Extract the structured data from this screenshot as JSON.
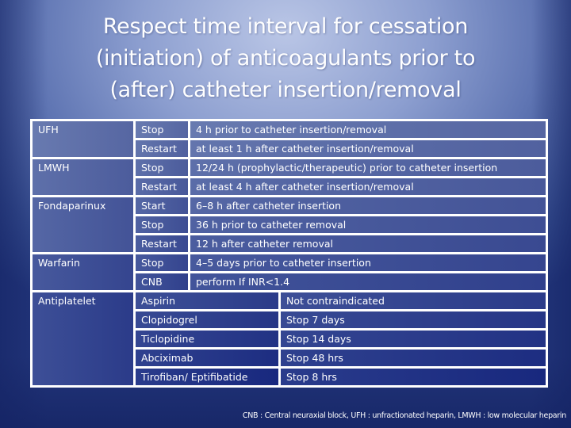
{
  "title": {
    "line1": "Respect time interval for cessation",
    "line2": "(initiation) of anticoagulants prior to",
    "line3": "(after) catheter insertion/removal"
  },
  "table": {
    "anticoagulants": [
      {
        "drug": "UFH",
        "rows": [
          {
            "action": "Stop",
            "detail": "4 h prior to catheter insertion/removal"
          },
          {
            "action": "Restart",
            "detail": "at least 1 h after catheter insertion/removal"
          }
        ]
      },
      {
        "drug": "LMWH",
        "rows": [
          {
            "action": "Stop",
            "detail": "12/24 h (prophylactic/therapeutic) prior to catheter insertion"
          },
          {
            "action": "Restart",
            "detail": "at least 4 h after catheter insertion/removal"
          }
        ]
      },
      {
        "drug": "Fondaparinux",
        "rows": [
          {
            "action": "Start",
            "detail": "6–8 h after catheter insertion"
          },
          {
            "action": "Stop",
            "detail": "36 h prior to catheter removal"
          },
          {
            "action": "Restart",
            "detail": "12 h after catheter removal"
          }
        ]
      },
      {
        "drug": "Warfarin",
        "rows": [
          {
            "action": "Stop",
            "detail": "4–5 days prior to catheter insertion"
          },
          {
            "action": "CNB",
            "detail": "perform If INR<1.4"
          }
        ]
      }
    ],
    "antiplatelet": {
      "drug": "Antiplatelet",
      "rows": [
        {
          "agent": "Aspirin",
          "recommendation": "Not contraindicated"
        },
        {
          "agent": "Clopidogrel",
          "recommendation": "Stop 7 days"
        },
        {
          "agent": "Ticlopidine",
          "recommendation": "Stop 14 days"
        },
        {
          "agent": "Abciximab",
          "recommendation": "Stop 48 hrs"
        },
        {
          "agent": "Tirofiban/ Eptifibatide",
          "recommendation": "Stop 8 hrs"
        }
      ]
    }
  },
  "footnote": "CNB : Central neuraxial block, UFH : unfractionated heparin, LMWH : low molecular heparin",
  "colors": {
    "text": "#ffffff",
    "border": "#ffffff",
    "background_light": "#bac6e6",
    "background_dark": "#22357a"
  }
}
